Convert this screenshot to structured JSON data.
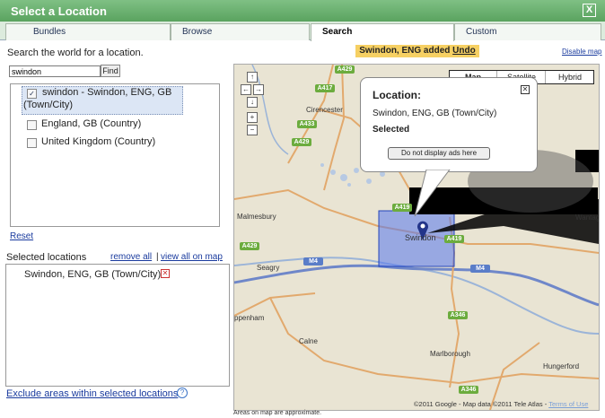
{
  "dialog": {
    "title": "Select a Location",
    "close_label": "X"
  },
  "tabs": [
    {
      "label": "Bundles"
    },
    {
      "label": "Browse"
    },
    {
      "label": "Search"
    },
    {
      "label": "Custom"
    }
  ],
  "search": {
    "instruction": "Search the world for a location.",
    "query": "swindon",
    "find_label": "Find",
    "results": [
      {
        "label": "swindon - Swindon, ENG, GB",
        "sub": "(Town/City)",
        "checked": true
      },
      {
        "label": "England, GB (Country)",
        "checked": false
      },
      {
        "label": "United Kingdom (Country)",
        "checked": false
      }
    ],
    "reset_label": "Reset"
  },
  "selected": {
    "heading": "Selected locations",
    "remove_all": "remove all",
    "view_all": "view all on map",
    "items": [
      "Swindon, ENG, GB (Town/City)"
    ],
    "exclude_label": "Exclude areas within selected locations",
    "help_icon": "?"
  },
  "notice": {
    "text": "Swindon, ENG added",
    "undo": "Undo"
  },
  "disable_map": "Disable map",
  "map": {
    "types": [
      "Map",
      "Satellite",
      "Hybrid"
    ],
    "active_type": "Map",
    "popup": {
      "title": "Location:",
      "name": "Swindon, ENG, GB (Town/City)",
      "status": "Selected",
      "button": "Do not display ads here"
    },
    "roads": [
      "A429",
      "A417",
      "A433",
      "A429",
      "A419",
      "A429",
      "M4",
      "A346",
      "A346",
      "A419",
      "M4"
    ],
    "towns": [
      "Cirencester",
      "Malmesbury",
      "Seagry",
      "Swindon",
      "Wantag",
      "ppenham",
      "Calne",
      "Marlborough",
      "Hungerford"
    ],
    "attribution": "©2011 Google - Map data ©2011 Tele Atlas -",
    "terms": "Terms of Use",
    "footnote": "Areas on map are approximate."
  },
  "colors": {
    "title_bar": "#5aa35f",
    "notice": "#f6d063",
    "selection": "#4466dd",
    "link": "#1a3b9e"
  }
}
